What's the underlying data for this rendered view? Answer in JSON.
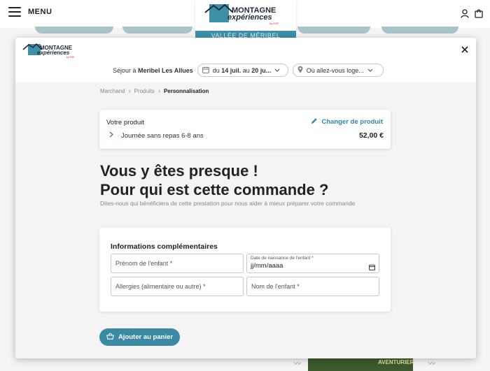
{
  "header": {
    "menu_label": "MENU",
    "valley_label": "VALLÉE DE MÉRIBEL",
    "background_photo_label": "AVENTURIER"
  },
  "logo": {
    "line1": "MONTAGNE",
    "line2": "expériences",
    "tagline": "by ESF"
  },
  "filters": {
    "stay_prefix": "Séjour à ",
    "stay_place": "Meribel Les Allues",
    "dates_prefix": "du ",
    "dates_start": "14 juil.",
    "dates_mid": " au ",
    "dates_end": "20 ju...",
    "location_placeholder": "Où allez-vous loge..."
  },
  "breadcrumb": {
    "items": [
      "Marchand",
      "Produits"
    ],
    "current": "Personnalisation"
  },
  "product": {
    "title": "Votre produit",
    "change_label": "Changer de produit",
    "name": "Journée sans repas 6-8 ans",
    "price": "52,00 €"
  },
  "headline": {
    "line1": "Vous y êtes presque !",
    "line2": "Pour qui est cette commande ?"
  },
  "subtext": "Dites-nous qui bénéficiera de cette prestation pour nous aider à mieux préparer votre commande",
  "form": {
    "title": "Informations complémentaires",
    "firstname_placeholder": "Prénom de l'enfant *",
    "birthdate_label": "Date de naissance de l'enfant *",
    "birthdate_value": "jj/mm/aaaa",
    "allergies_placeholder": "Allergies (alimentaire ou autre) *",
    "lastname_placeholder": "Nom de l'enfant *"
  },
  "cart_button_label": "Ajouter au panier",
  "colors": {
    "accent": "#3b8aa4",
    "link": "#2e86a6",
    "logo_red": "#d8232a"
  }
}
